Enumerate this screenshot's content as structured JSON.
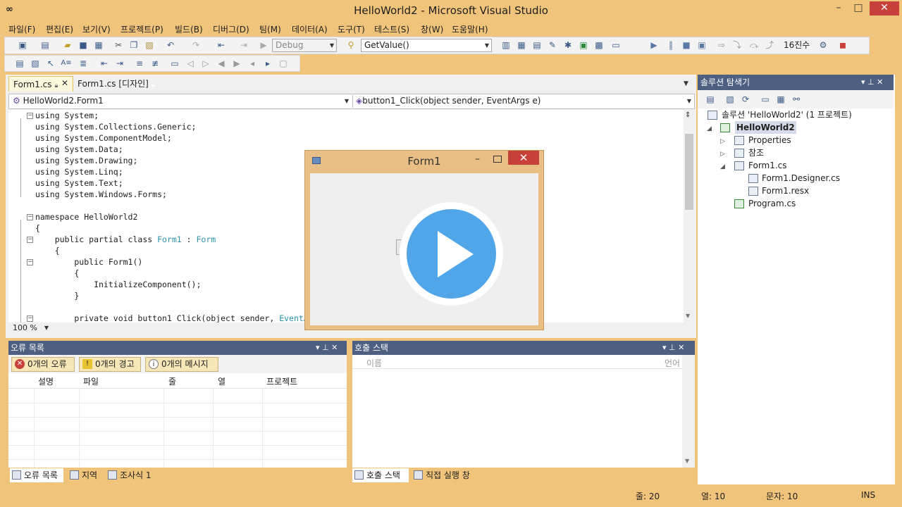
{
  "window": {
    "title": "HelloWorld2 - Microsoft Visual Studio",
    "logo": "∞",
    "minimize": "–",
    "maximize": "□",
    "close": "✕"
  },
  "menu": [
    "파일(F)",
    "편집(E)",
    "보기(V)",
    "프로젝트(P)",
    "빌드(B)",
    "디버그(D)",
    "팀(M)",
    "데이터(A)",
    "도구(T)",
    "테스트(S)",
    "창(W)",
    "도움말(H)"
  ],
  "toolbar": {
    "config_value": "Debug",
    "find_value": "GetValue()",
    "hex_label": "16진수"
  },
  "doc_tabs": {
    "active_label": "Form1.cs",
    "designer_label": "Form1.cs [디자인]",
    "close": "✕"
  },
  "nav": {
    "type_value": "HelloWorld2.Form1",
    "member_value": "button1_Click(object sender, EventArgs e)"
  },
  "code_lines": [
    "using System;",
    "using System.Collections.Generic;",
    "using System.ComponentModel;",
    "using System.Data;",
    "using System.Drawing;",
    "using System.Linq;",
    "using System.Text;",
    "using System.Windows.Forms;",
    "",
    "namespace HelloWorld2",
    "{",
    "    public partial class ",
    "    {",
    "        public Form1()",
    "        {",
    "            InitializeComponent();",
    "        }",
    "",
    "        private void button1_Click(object sender, "
  ],
  "code_types": {
    "class_name": "Form1",
    "colon": " : ",
    "base_type": "Form",
    "event_args": "EventArgs"
  },
  "zoom": "100 %",
  "form1": {
    "title": "Form1",
    "minimize": "–",
    "close": "✕"
  },
  "solution_explorer": {
    "header": "솔루션 탐색기",
    "pin": "▾ ⊥ ✕",
    "root": "솔루션 'HelloWorld2' (1 프로젝트)",
    "project": "HelloWorld2",
    "items": [
      "Properties",
      "참조",
      "Form1.cs",
      "Form1.Designer.cs",
      "Form1.resx",
      "Program.cs"
    ]
  },
  "error_list": {
    "header": "오류 목록",
    "controls": "▾ ⊥ ✕",
    "errors": "0개의 오류",
    "warnings": "0개의 경고",
    "messages": "0개의 메시지",
    "columns": [
      "설명",
      "파일",
      "줄",
      "열",
      "프로젝트"
    ]
  },
  "call_stack": {
    "header": "호출 스택",
    "controls": "▾ ⊥ ✕",
    "col_name": "이름",
    "col_lang": "언어"
  },
  "bottom_tabs_left": [
    "오류 목록",
    "지역",
    "조사식 1"
  ],
  "bottom_tabs_right": [
    "호출 스택",
    "직접 실행 창"
  ],
  "status": {
    "line": "줄: 20",
    "col": "열: 10",
    "char": "문자: 10",
    "mode": "INS"
  }
}
